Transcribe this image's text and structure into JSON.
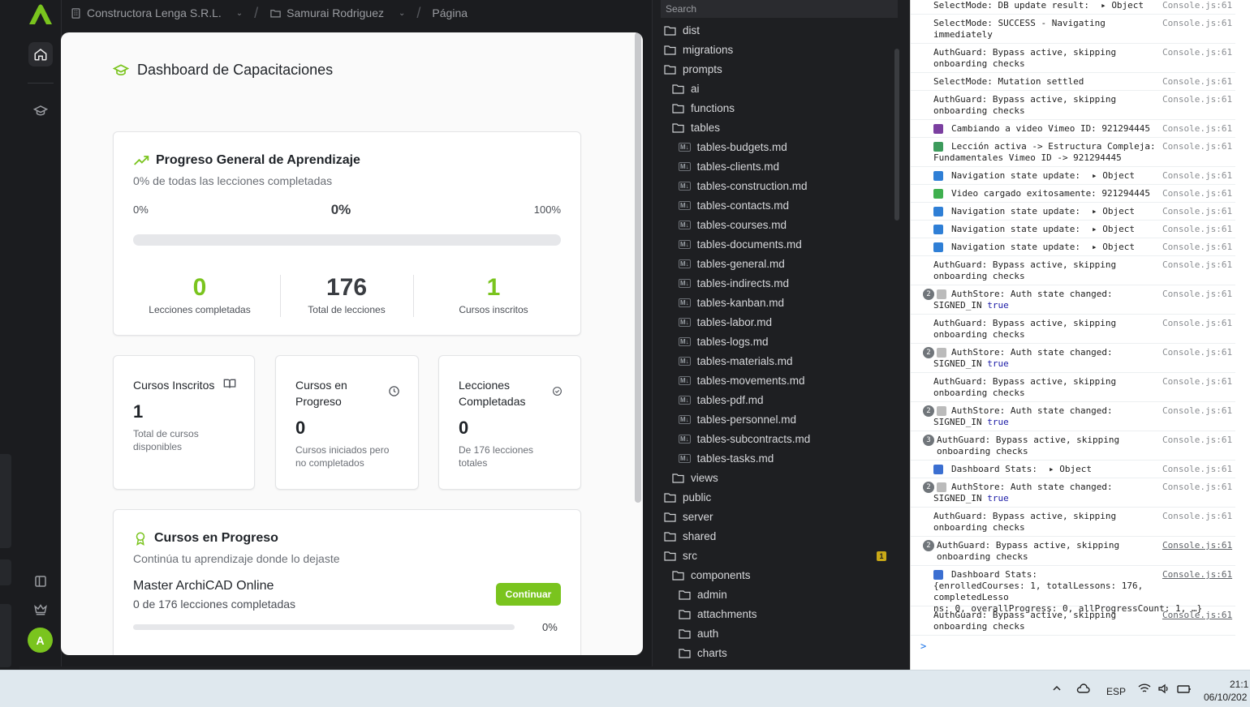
{
  "colors": {
    "accent": "#7ac41e",
    "dark_bg": "#1b1c1f",
    "console_bg": "#ffffff",
    "taskbar_bg": "#dfe8ee",
    "warning_badge": "#c9a817"
  },
  "app": {
    "breadcrumb": {
      "company": "Constructora Lenga S.R.L.",
      "user": "Samurai Rodriguez",
      "page": "Página"
    },
    "rail": {
      "avatar_initial": "A",
      "icons": [
        "home-icon",
        "graduation-cap-icon",
        "sidebar-toggle-icon",
        "crown-icon"
      ]
    },
    "dashboard": {
      "title": "Dashboard de Capacitaciones",
      "progress_card": {
        "title": "Progreso General de Aprendizaje",
        "subtitle": "0% de todas las lecciones completadas",
        "min_label": "0%",
        "current_label": "0%",
        "max_label": "100%",
        "progress_fraction": 0,
        "stats": [
          {
            "value": "0",
            "label": "Lecciones completadas",
            "color": "#7ac41e"
          },
          {
            "value": "176",
            "label": "Total de lecciones",
            "color": "#3a3d42"
          },
          {
            "value": "1",
            "label": "Cursos inscritos",
            "color": "#7ac41e"
          }
        ]
      },
      "mini_cards": [
        {
          "title": "Cursos Inscritos",
          "value": "1",
          "desc": "Total de cursos disponibles",
          "icon": "book-open-icon"
        },
        {
          "title": "Cursos en Progreso",
          "value": "0",
          "desc": "Cursos iniciados pero no completados",
          "icon": "clock-icon"
        },
        {
          "title": "Lecciones Completadas",
          "value": "0",
          "desc": "De 176 lecciones totales",
          "icon": "check-circle-icon"
        }
      ],
      "in_progress": {
        "title": "Cursos en Progreso",
        "subtitle": "Continúa tu aprendizaje donde lo dejaste",
        "course_name": "Master ArchiCAD Online",
        "course_detail": "0 de 176 lecciones completadas",
        "button": "Continuar",
        "percent": "0%",
        "progress_fraction": 0
      }
    }
  },
  "explorer": {
    "search_placeholder": "Search",
    "badge": "1",
    "items": [
      {
        "name": "dist",
        "type": "folder",
        "level": 0
      },
      {
        "name": "migrations",
        "type": "folder",
        "level": 0
      },
      {
        "name": "prompts",
        "type": "folder",
        "level": 0
      },
      {
        "name": "ai",
        "type": "folder",
        "level": 1
      },
      {
        "name": "functions",
        "type": "folder",
        "level": 1
      },
      {
        "name": "tables",
        "type": "folder",
        "level": 1
      },
      {
        "name": "tables-budgets.md",
        "type": "md",
        "level": 2
      },
      {
        "name": "tables-clients.md",
        "type": "md",
        "level": 2
      },
      {
        "name": "tables-construction.md",
        "type": "md",
        "level": 2
      },
      {
        "name": "tables-contacts.md",
        "type": "md",
        "level": 2
      },
      {
        "name": "tables-courses.md",
        "type": "md",
        "level": 2
      },
      {
        "name": "tables-documents.md",
        "type": "md",
        "level": 2
      },
      {
        "name": "tables-general.md",
        "type": "md",
        "level": 2
      },
      {
        "name": "tables-indirects.md",
        "type": "md",
        "level": 2
      },
      {
        "name": "tables-kanban.md",
        "type": "md",
        "level": 2
      },
      {
        "name": "tables-labor.md",
        "type": "md",
        "level": 2
      },
      {
        "name": "tables-logs.md",
        "type": "md",
        "level": 2
      },
      {
        "name": "tables-materials.md",
        "type": "md",
        "level": 2
      },
      {
        "name": "tables-movements.md",
        "type": "md",
        "level": 2
      },
      {
        "name": "tables-pdf.md",
        "type": "md",
        "level": 2
      },
      {
        "name": "tables-personnel.md",
        "type": "md",
        "level": 2
      },
      {
        "name": "tables-subcontracts.md",
        "type": "md",
        "level": 2
      },
      {
        "name": "tables-tasks.md",
        "type": "md",
        "level": 2
      },
      {
        "name": "views",
        "type": "folder",
        "level": 1
      },
      {
        "name": "public",
        "type": "folder",
        "level": 0
      },
      {
        "name": "server",
        "type": "folder",
        "level": 0
      },
      {
        "name": "shared",
        "type": "folder",
        "level": 0
      },
      {
        "name": "src",
        "type": "folder",
        "level": 0
      },
      {
        "name": "components",
        "type": "folder",
        "level": 1
      },
      {
        "name": "admin",
        "type": "folder",
        "level": 2
      },
      {
        "name": "attachments",
        "type": "folder",
        "level": 2
      },
      {
        "name": "auth",
        "type": "folder",
        "level": 2
      },
      {
        "name": "charts",
        "type": "folder",
        "level": 2
      }
    ]
  },
  "console": {
    "source": "Console.js:61",
    "prompt": ">",
    "logs": [
      {
        "text": "SelectMode: DB update result:",
        "obj": "Object",
        "count": "",
        "emoji": ""
      },
      {
        "text": "SelectMode: SUCCESS - Navigating\nimmediately",
        "count": "",
        "emoji": ""
      },
      {
        "text": "AuthGuard: Bypass active, skipping\nonboarding checks",
        "count": "",
        "emoji": ""
      },
      {
        "text": "SelectMode: Mutation settled",
        "count": "",
        "emoji": ""
      },
      {
        "text": "AuthGuard: Bypass active, skipping\nonboarding checks",
        "count": "",
        "emoji": ""
      },
      {
        "text": "Cambiando a video Vimeo ID: 921294445",
        "count": "",
        "emoji": "#7b3fa0"
      },
      {
        "text": "Lección activa -> Estructura Compleja:\nFundamentales Vimeo ID -> 921294445",
        "count": "",
        "emoji": "#3d9b5c"
      },
      {
        "text": "Navigation state update:",
        "obj": "Object",
        "count": "",
        "emoji": "#2f7fd6"
      },
      {
        "text": "Video cargado exitosamente: 921294445",
        "count": "",
        "emoji": "#3fb04f"
      },
      {
        "text": "Navigation state update:",
        "obj": "Object",
        "count": "",
        "emoji": "#2f7fd6"
      },
      {
        "text": "Navigation state update:",
        "obj": "Object",
        "count": "",
        "emoji": "#2f7fd6"
      },
      {
        "text": "Navigation state update:",
        "obj": "Object",
        "count": "",
        "emoji": "#2f7fd6"
      },
      {
        "text": "AuthGuard: Bypass active, skipping\nonboarding checks",
        "count": "",
        "emoji": ""
      },
      {
        "text": "AuthStore: Auth state changed:\nSIGNED_IN",
        "tru": "true",
        "count": "2",
        "emoji": "#bbbbbb"
      },
      {
        "text": "AuthGuard: Bypass active, skipping\nonboarding checks",
        "count": "",
        "emoji": ""
      },
      {
        "text": "AuthStore: Auth state changed:\nSIGNED_IN",
        "tru": "true",
        "count": "2",
        "emoji": "#bbbbbb"
      },
      {
        "text": "AuthGuard: Bypass active, skipping\nonboarding checks",
        "count": "",
        "emoji": ""
      },
      {
        "text": "AuthStore: Auth state changed:\nSIGNED_IN",
        "tru": "true",
        "count": "2",
        "emoji": "#bbbbbb"
      },
      {
        "text": "AuthGuard: Bypass active, skipping\nonboarding checks",
        "count": "3",
        "emoji": ""
      },
      {
        "text": "Dashboard Stats:",
        "obj": "Object",
        "count": "",
        "emoji": "#3b6fd1"
      },
      {
        "text": "AuthStore: Auth state changed:\nSIGNED_IN",
        "tru": "true",
        "count": "2",
        "emoji": "#bbbbbb"
      },
      {
        "text": "AuthGuard: Bypass active, skipping\nonboarding checks",
        "count": "",
        "emoji": ""
      },
      {
        "text": "AuthGuard: Bypass active, skipping\nonboarding checks",
        "count": "2",
        "emoji": ""
      },
      {
        "text": "Dashboard Stats:\n{enrolledCourses: 1, totalLessons: 176, completedLesso\nns: 0, overallProgress: 0, allProgressCount: 1, …}",
        "count": "",
        "emoji": "#3b6fd1"
      },
      {
        "text": "AuthGuard: Bypass active, skipping\nonboarding checks",
        "count": "",
        "emoji": ""
      }
    ]
  },
  "taskbar": {
    "lang": "ESP",
    "time": "21:1",
    "date": "06/10/202"
  }
}
